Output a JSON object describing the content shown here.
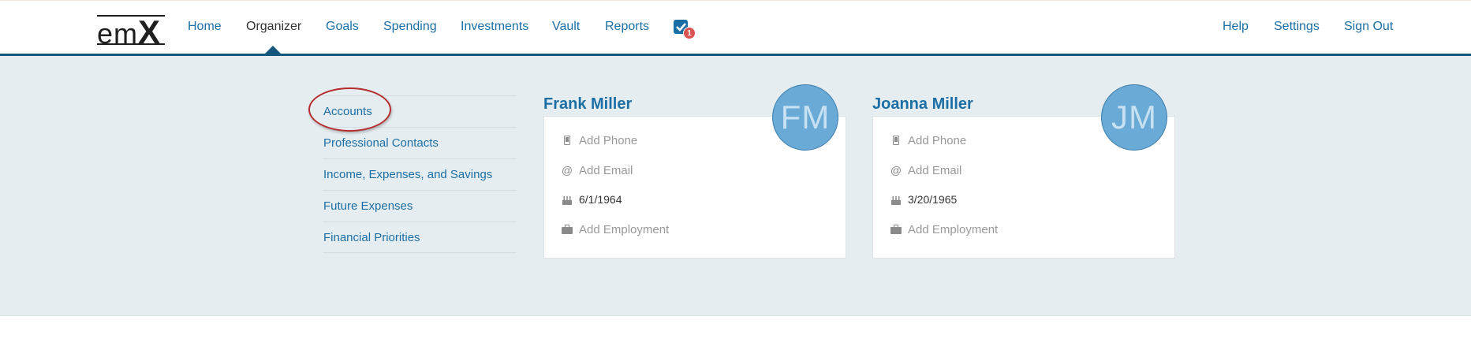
{
  "logo": {
    "text_em": "em",
    "text_x": "X"
  },
  "nav": {
    "items": [
      {
        "label": "Home"
      },
      {
        "label": "Organizer"
      },
      {
        "label": "Goals"
      },
      {
        "label": "Spending"
      },
      {
        "label": "Investments"
      },
      {
        "label": "Vault"
      },
      {
        "label": "Reports"
      }
    ],
    "active": "Organizer",
    "tasks_badge": "1",
    "right": [
      {
        "label": "Help"
      },
      {
        "label": "Settings"
      },
      {
        "label": "Sign Out"
      }
    ]
  },
  "sidebar": {
    "items": [
      {
        "label": "Accounts"
      },
      {
        "label": "Professional Contacts"
      },
      {
        "label": "Income, Expenses, and Savings"
      },
      {
        "label": "Future Expenses"
      },
      {
        "label": "Financial Priorities"
      }
    ]
  },
  "people": [
    {
      "name": "Frank Miller",
      "initials": "FM",
      "phone": "Add Phone",
      "email": "Add Email",
      "birthdate": "6/1/1964",
      "employment": "Add Employment"
    },
    {
      "name": "Joanna Miller",
      "initials": "JM",
      "phone": "Add Phone",
      "email": "Add Email",
      "birthdate": "3/20/1965",
      "employment": "Add Employment"
    }
  ],
  "colors": {
    "link": "#1b6fa5",
    "nav_border": "#15567d",
    "background": "#e6edf1",
    "avatar": "#6aaad6",
    "annotation": "#b42c2c",
    "badge": "#d9534f"
  }
}
